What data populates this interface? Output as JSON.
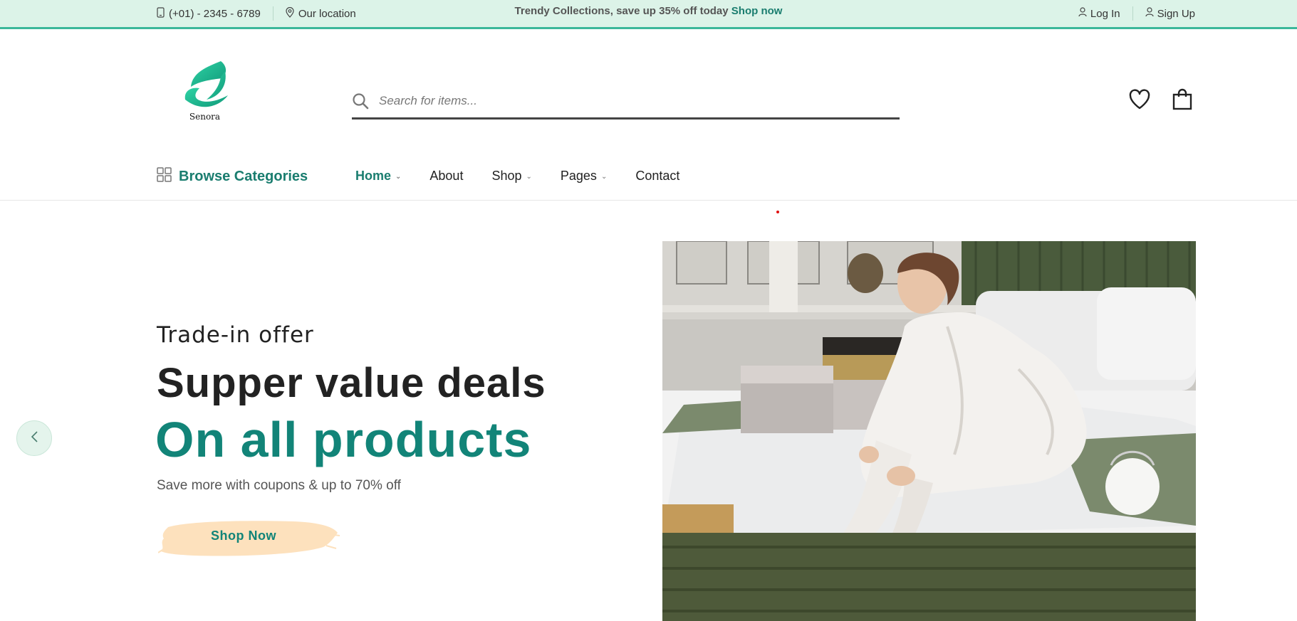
{
  "topbar": {
    "phone": "(+01) - 2345 - 6789",
    "location": "Our location",
    "promo_text": "Trendy Collections, save up 35% off today",
    "promo_link": "Shop now",
    "login": "Log In",
    "signup": "Sign Up"
  },
  "logo": {
    "name": "Senora"
  },
  "search": {
    "placeholder": "Search for items..."
  },
  "nav": {
    "browse": "Browse Categories",
    "items": [
      {
        "label": "Home",
        "active": true,
        "has_dropdown": true
      },
      {
        "label": "About",
        "active": false,
        "has_dropdown": false
      },
      {
        "label": "Shop",
        "active": false,
        "has_dropdown": true
      },
      {
        "label": "Pages",
        "active": false,
        "has_dropdown": true
      },
      {
        "label": "Contact",
        "active": false,
        "has_dropdown": false
      }
    ]
  },
  "hero": {
    "subtitle": "Trade-in offer",
    "title_line1": "Supper value deals",
    "title_line2": "On all products",
    "description": "Save more with coupons & up to 70% off",
    "cta": "Shop Now"
  },
  "colors": {
    "accent": "#128478",
    "topbar_bg": "#dcf3e8",
    "topbar_border": "#3bb79a",
    "cta_brush": "#fde1bd"
  }
}
